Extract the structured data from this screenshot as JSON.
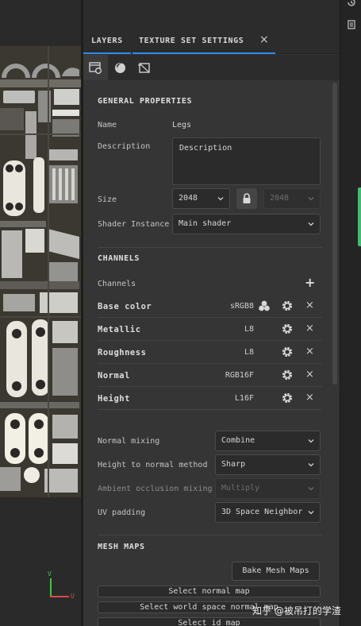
{
  "viewport": {
    "axis_v": "V",
    "axis_u": "U"
  },
  "tabs": {
    "layers": "LAYERS",
    "texture_set_settings": "TEXTURE SET SETTINGS",
    "close": "×"
  },
  "general": {
    "header": "GENERAL PROPERTIES",
    "name_label": "Name",
    "name_value": "Legs",
    "description_label": "Description",
    "description_value": "Description",
    "size_label": "Size",
    "size_value": "2048",
    "size_value_linked": "2048",
    "shader_label": "Shader Instance",
    "shader_value": "Main shader"
  },
  "channels": {
    "header": "CHANNELS",
    "label": "Channels",
    "add": "+",
    "items": [
      {
        "name": "Base color",
        "format": "sRGB8"
      },
      {
        "name": "Metallic",
        "format": "L8"
      },
      {
        "name": "Roughness",
        "format": "L8"
      },
      {
        "name": "Normal",
        "format": "RGB16F"
      },
      {
        "name": "Height",
        "format": "L16F"
      }
    ]
  },
  "mixing": {
    "normal_mixing_label": "Normal mixing",
    "normal_mixing_value": "Combine",
    "height_to_normal_label": "Height to normal method",
    "height_to_normal_value": "Sharp",
    "ao_mixing_label": "Ambient occlusion mixing",
    "ao_mixing_value": "Multiply",
    "uv_padding_label": "UV padding",
    "uv_padding_value": "3D Space Neighbor"
  },
  "mesh_maps": {
    "header": "MESH MAPS",
    "bake_button": "Bake Mesh Maps",
    "select_normal": "Select normal map",
    "select_world_normal": "Select world space normal map",
    "select_id": "Select id map"
  },
  "watermark": "知乎 @被吊打的学渣",
  "colors": {
    "accent": "#2d8ceb",
    "panel": "#353535",
    "green": "#3fbf6a"
  }
}
